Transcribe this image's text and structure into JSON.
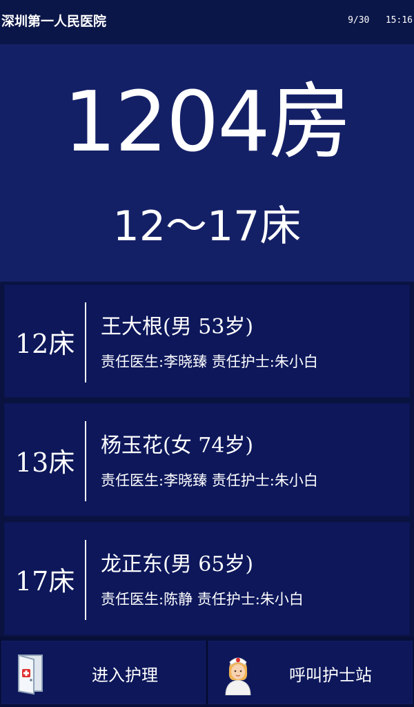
{
  "header": {
    "hospital_name": "深圳第一人民医院",
    "date": "9/30",
    "time": "15:16"
  },
  "room": {
    "number": "1204房",
    "bed_range": "12～17床"
  },
  "beds": [
    {
      "bed": "12床",
      "patient": "王大根(男 53岁)",
      "staff": "责任医生:李晓臻 责任护士:朱小白"
    },
    {
      "bed": "13床",
      "patient": "杨玉花(女 74岁)",
      "staff": "责任医生:李晓臻 责任护士:朱小白"
    },
    {
      "bed": "17床",
      "patient": "龙正东(男 65岁)",
      "staff": "责任医生:陈静 责任护士:朱小白"
    }
  ],
  "actions": {
    "enter_care_label": "进入护理",
    "enter_care_icon": "door-icon",
    "call_nurse_label": "呼叫护士站",
    "call_nurse_icon": "nurse-icon"
  },
  "colors": {
    "background": "#0a1340",
    "header": "#0b1648",
    "room_panel": "#142066",
    "card": "#0d175a",
    "text": "#ffffff"
  }
}
